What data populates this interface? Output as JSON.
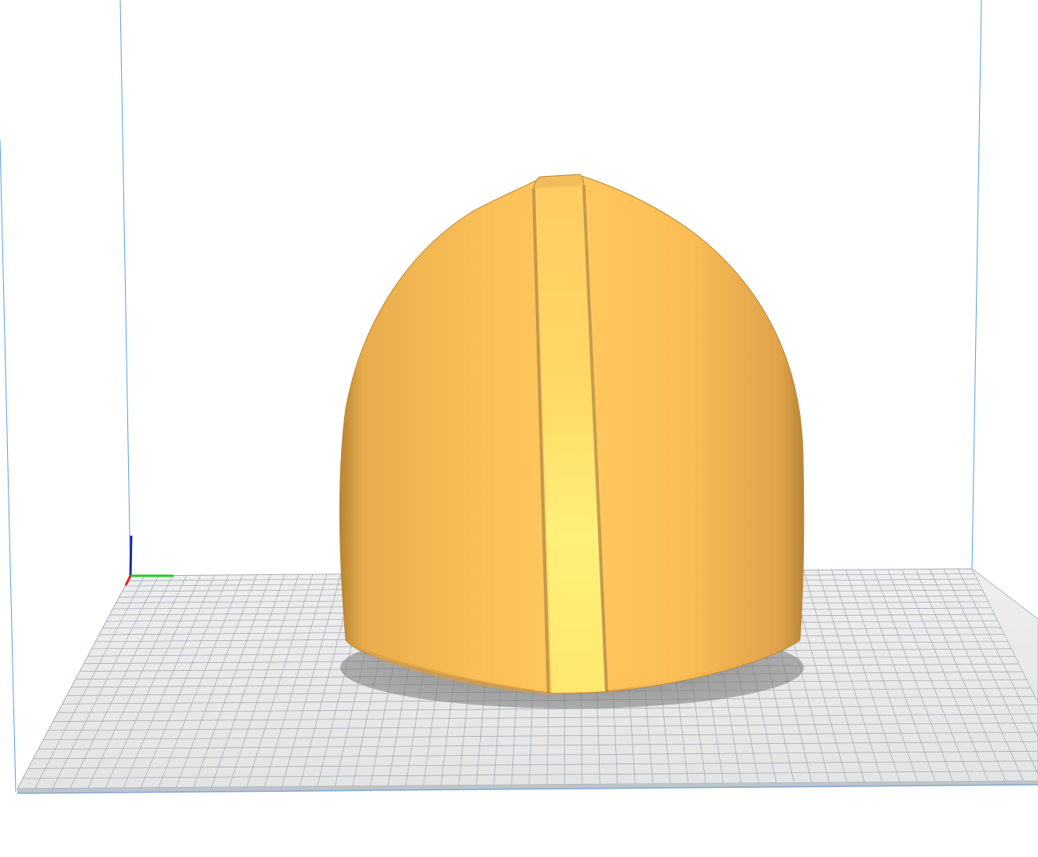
{
  "viewport": {
    "background_color": "#ffffff",
    "build_volume_edge_color": "#4a90d9",
    "build_plate_color": "#e8e8e8",
    "grid_line_color": "#8a9aa8",
    "plate_edge_color": "#a8b0b8"
  },
  "model": {
    "color_base": "#f5b956",
    "color_light": "#ffd566",
    "color_highlight": "#fff27a",
    "color_shadow": "#c88f3c"
  },
  "axis_gizmo": {
    "x_color": "#e02020",
    "y_color": "#22cc22",
    "z_color": "#1a2aa8"
  }
}
